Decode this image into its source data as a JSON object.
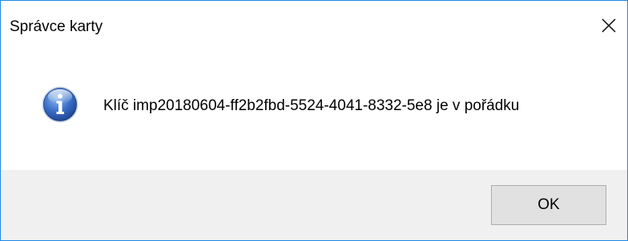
{
  "dialog": {
    "title": "Správce karty",
    "message": "Klíč imp20180604-ff2b2fbd-5524-4041-8332-5e8 je v pořádku",
    "icon": "info-icon",
    "ok_label": "OK",
    "close_icon": "close-icon"
  },
  "colors": {
    "border": "#1e88e5",
    "footer_bg": "#f0f0f0",
    "button_bg": "#e1e1e1",
    "button_border": "#adadad",
    "icon_blue": "#2a5fb8"
  }
}
